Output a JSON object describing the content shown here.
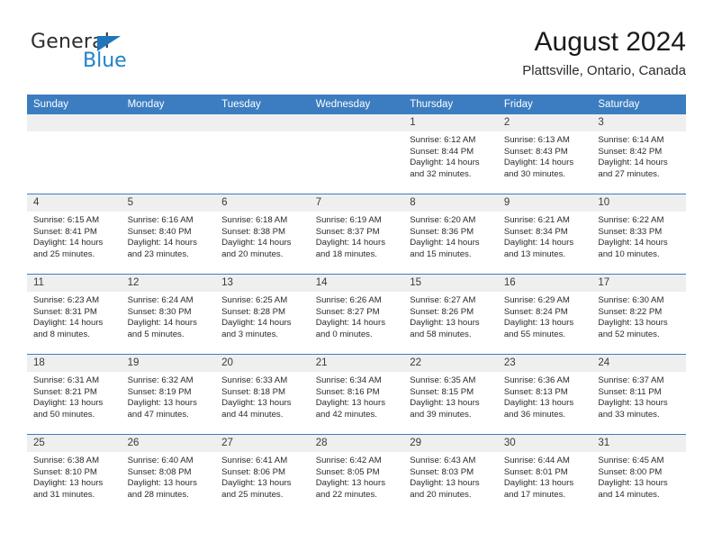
{
  "brand": {
    "name_part1": "General",
    "name_part2": "Blue",
    "triangle_color": "#1f76bd",
    "blue_color": "#1f82c8"
  },
  "header": {
    "title": "August 2024",
    "subtitle": "Plattsville, Ontario, Canada"
  },
  "theme": {
    "header_blue": "#3b7dc0",
    "daynum_gray": "#efefef"
  },
  "weekdays": [
    "Sunday",
    "Monday",
    "Tuesday",
    "Wednesday",
    "Thursday",
    "Friday",
    "Saturday"
  ],
  "weeks": [
    [
      {
        "day": "",
        "sunrise": "",
        "sunset": "",
        "daylight1": "",
        "daylight2": "",
        "empty": true
      },
      {
        "day": "",
        "sunrise": "",
        "sunset": "",
        "daylight1": "",
        "daylight2": "",
        "empty": true
      },
      {
        "day": "",
        "sunrise": "",
        "sunset": "",
        "daylight1": "",
        "daylight2": "",
        "empty": true
      },
      {
        "day": "",
        "sunrise": "",
        "sunset": "",
        "daylight1": "",
        "daylight2": "",
        "empty": true
      },
      {
        "day": "1",
        "sunrise": "Sunrise: 6:12 AM",
        "sunset": "Sunset: 8:44 PM",
        "daylight1": "Daylight: 14 hours",
        "daylight2": "and 32 minutes."
      },
      {
        "day": "2",
        "sunrise": "Sunrise: 6:13 AM",
        "sunset": "Sunset: 8:43 PM",
        "daylight1": "Daylight: 14 hours",
        "daylight2": "and 30 minutes."
      },
      {
        "day": "3",
        "sunrise": "Sunrise: 6:14 AM",
        "sunset": "Sunset: 8:42 PM",
        "daylight1": "Daylight: 14 hours",
        "daylight2": "and 27 minutes."
      }
    ],
    [
      {
        "day": "4",
        "sunrise": "Sunrise: 6:15 AM",
        "sunset": "Sunset: 8:41 PM",
        "daylight1": "Daylight: 14 hours",
        "daylight2": "and 25 minutes."
      },
      {
        "day": "5",
        "sunrise": "Sunrise: 6:16 AM",
        "sunset": "Sunset: 8:40 PM",
        "daylight1": "Daylight: 14 hours",
        "daylight2": "and 23 minutes."
      },
      {
        "day": "6",
        "sunrise": "Sunrise: 6:18 AM",
        "sunset": "Sunset: 8:38 PM",
        "daylight1": "Daylight: 14 hours",
        "daylight2": "and 20 minutes."
      },
      {
        "day": "7",
        "sunrise": "Sunrise: 6:19 AM",
        "sunset": "Sunset: 8:37 PM",
        "daylight1": "Daylight: 14 hours",
        "daylight2": "and 18 minutes."
      },
      {
        "day": "8",
        "sunrise": "Sunrise: 6:20 AM",
        "sunset": "Sunset: 8:36 PM",
        "daylight1": "Daylight: 14 hours",
        "daylight2": "and 15 minutes."
      },
      {
        "day": "9",
        "sunrise": "Sunrise: 6:21 AM",
        "sunset": "Sunset: 8:34 PM",
        "daylight1": "Daylight: 14 hours",
        "daylight2": "and 13 minutes."
      },
      {
        "day": "10",
        "sunrise": "Sunrise: 6:22 AM",
        "sunset": "Sunset: 8:33 PM",
        "daylight1": "Daylight: 14 hours",
        "daylight2": "and 10 minutes."
      }
    ],
    [
      {
        "day": "11",
        "sunrise": "Sunrise: 6:23 AM",
        "sunset": "Sunset: 8:31 PM",
        "daylight1": "Daylight: 14 hours",
        "daylight2": "and 8 minutes."
      },
      {
        "day": "12",
        "sunrise": "Sunrise: 6:24 AM",
        "sunset": "Sunset: 8:30 PM",
        "daylight1": "Daylight: 14 hours",
        "daylight2": "and 5 minutes."
      },
      {
        "day": "13",
        "sunrise": "Sunrise: 6:25 AM",
        "sunset": "Sunset: 8:28 PM",
        "daylight1": "Daylight: 14 hours",
        "daylight2": "and 3 minutes."
      },
      {
        "day": "14",
        "sunrise": "Sunrise: 6:26 AM",
        "sunset": "Sunset: 8:27 PM",
        "daylight1": "Daylight: 14 hours",
        "daylight2": "and 0 minutes."
      },
      {
        "day": "15",
        "sunrise": "Sunrise: 6:27 AM",
        "sunset": "Sunset: 8:26 PM",
        "daylight1": "Daylight: 13 hours",
        "daylight2": "and 58 minutes."
      },
      {
        "day": "16",
        "sunrise": "Sunrise: 6:29 AM",
        "sunset": "Sunset: 8:24 PM",
        "daylight1": "Daylight: 13 hours",
        "daylight2": "and 55 minutes."
      },
      {
        "day": "17",
        "sunrise": "Sunrise: 6:30 AM",
        "sunset": "Sunset: 8:22 PM",
        "daylight1": "Daylight: 13 hours",
        "daylight2": "and 52 minutes."
      }
    ],
    [
      {
        "day": "18",
        "sunrise": "Sunrise: 6:31 AM",
        "sunset": "Sunset: 8:21 PM",
        "daylight1": "Daylight: 13 hours",
        "daylight2": "and 50 minutes."
      },
      {
        "day": "19",
        "sunrise": "Sunrise: 6:32 AM",
        "sunset": "Sunset: 8:19 PM",
        "daylight1": "Daylight: 13 hours",
        "daylight2": "and 47 minutes."
      },
      {
        "day": "20",
        "sunrise": "Sunrise: 6:33 AM",
        "sunset": "Sunset: 8:18 PM",
        "daylight1": "Daylight: 13 hours",
        "daylight2": "and 44 minutes."
      },
      {
        "day": "21",
        "sunrise": "Sunrise: 6:34 AM",
        "sunset": "Sunset: 8:16 PM",
        "daylight1": "Daylight: 13 hours",
        "daylight2": "and 42 minutes."
      },
      {
        "day": "22",
        "sunrise": "Sunrise: 6:35 AM",
        "sunset": "Sunset: 8:15 PM",
        "daylight1": "Daylight: 13 hours",
        "daylight2": "and 39 minutes."
      },
      {
        "day": "23",
        "sunrise": "Sunrise: 6:36 AM",
        "sunset": "Sunset: 8:13 PM",
        "daylight1": "Daylight: 13 hours",
        "daylight2": "and 36 minutes."
      },
      {
        "day": "24",
        "sunrise": "Sunrise: 6:37 AM",
        "sunset": "Sunset: 8:11 PM",
        "daylight1": "Daylight: 13 hours",
        "daylight2": "and 33 minutes."
      }
    ],
    [
      {
        "day": "25",
        "sunrise": "Sunrise: 6:38 AM",
        "sunset": "Sunset: 8:10 PM",
        "daylight1": "Daylight: 13 hours",
        "daylight2": "and 31 minutes."
      },
      {
        "day": "26",
        "sunrise": "Sunrise: 6:40 AM",
        "sunset": "Sunset: 8:08 PM",
        "daylight1": "Daylight: 13 hours",
        "daylight2": "and 28 minutes."
      },
      {
        "day": "27",
        "sunrise": "Sunrise: 6:41 AM",
        "sunset": "Sunset: 8:06 PM",
        "daylight1": "Daylight: 13 hours",
        "daylight2": "and 25 minutes."
      },
      {
        "day": "28",
        "sunrise": "Sunrise: 6:42 AM",
        "sunset": "Sunset: 8:05 PM",
        "daylight1": "Daylight: 13 hours",
        "daylight2": "and 22 minutes."
      },
      {
        "day": "29",
        "sunrise": "Sunrise: 6:43 AM",
        "sunset": "Sunset: 8:03 PM",
        "daylight1": "Daylight: 13 hours",
        "daylight2": "and 20 minutes."
      },
      {
        "day": "30",
        "sunrise": "Sunrise: 6:44 AM",
        "sunset": "Sunset: 8:01 PM",
        "daylight1": "Daylight: 13 hours",
        "daylight2": "and 17 minutes."
      },
      {
        "day": "31",
        "sunrise": "Sunrise: 6:45 AM",
        "sunset": "Sunset: 8:00 PM",
        "daylight1": "Daylight: 13 hours",
        "daylight2": "and 14 minutes."
      }
    ]
  ]
}
